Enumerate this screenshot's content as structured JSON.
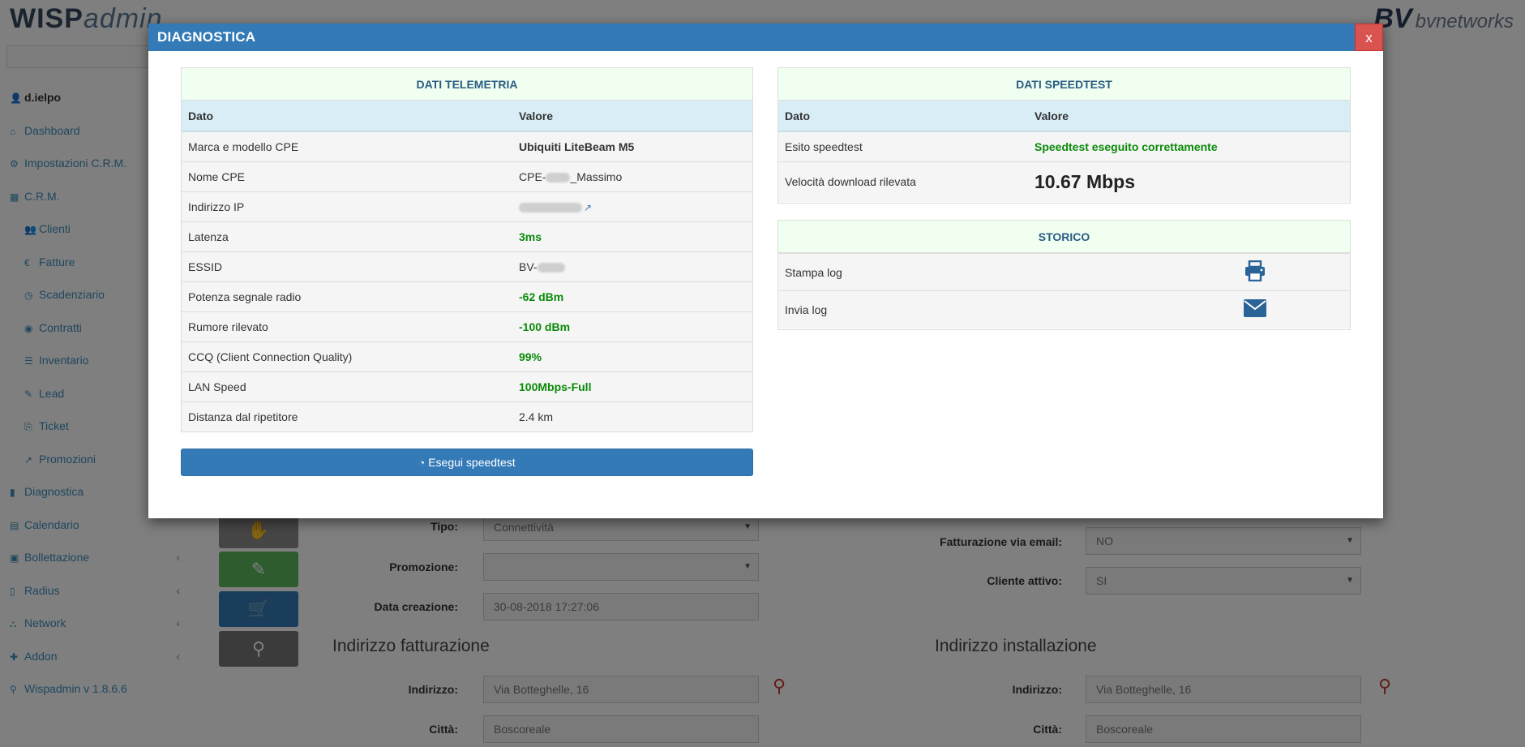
{
  "background": {
    "logo": {
      "main": "WISP",
      "sub": "admin"
    },
    "brand": {
      "mark": "BV",
      "name": "bvnetworks"
    },
    "sidebar": [
      {
        "icon": "user-icon",
        "glyph": "👤",
        "label": "d.ielpo",
        "type": "user"
      },
      {
        "icon": "dashboard-icon",
        "glyph": "⌂",
        "label": "Dashboard"
      },
      {
        "icon": "settings-icon",
        "glyph": "⚙",
        "label": "Impostazioni C.R.M."
      },
      {
        "icon": "table-icon",
        "glyph": "▦",
        "label": "C.R.M."
      },
      {
        "icon": "users-icon",
        "glyph": "👥",
        "label": "Clienti",
        "sub": true
      },
      {
        "icon": "euro-icon",
        "glyph": "€",
        "label": "Fatture",
        "sub": true
      },
      {
        "icon": "clock-icon",
        "glyph": "◷",
        "label": "Scadenziario",
        "sub": true
      },
      {
        "icon": "eye-icon",
        "glyph": "◉",
        "label": "Contratti",
        "sub": true
      },
      {
        "icon": "list-icon",
        "glyph": "☰",
        "label": "Inventario",
        "sub": true
      },
      {
        "icon": "edit-icon",
        "glyph": "✎",
        "label": "Lead",
        "sub": true
      },
      {
        "icon": "ticket-icon",
        "glyph": "⎘",
        "label": "Ticket",
        "sub": true
      },
      {
        "icon": "chart-icon",
        "glyph": "↗",
        "label": "Promozioni",
        "sub": true
      },
      {
        "icon": "bar-chart-icon",
        "glyph": "▮",
        "label": "Diagnostica"
      },
      {
        "icon": "calendar-icon",
        "glyph": "▤",
        "label": "Calendario"
      },
      {
        "icon": "money-icon",
        "glyph": "▣",
        "label": "Bollettazione",
        "chev": true
      },
      {
        "icon": "file-icon",
        "glyph": "▯",
        "label": "Radius",
        "chev": true
      },
      {
        "icon": "network-icon",
        "glyph": "⛬",
        "label": "Network",
        "chev": true
      },
      {
        "icon": "addon-icon",
        "glyph": "✚",
        "label": "Addon",
        "chev": true
      },
      {
        "icon": "pin-icon",
        "glyph": "⚲",
        "label": "Wispadmin v 1.8.6.6"
      }
    ],
    "form": {
      "tipo_label": "Tipo:",
      "tipo_value": "Connettività",
      "promozione_label": "Promozione:",
      "promozione_value": "",
      "data_creazione_label": "Data creazione:",
      "data_creazione_value": "30-08-2018 17:27:06",
      "fatt_email_label": "Fatturazione via email:",
      "fatt_email_value": "NO",
      "cliente_attivo_label": "Cliente attivo:",
      "cliente_attivo_value": "SI",
      "indirizzo_fatturazione": "Indirizzo fatturazione",
      "indirizzo_installazione": "Indirizzo installazione",
      "indirizzo_label": "Indirizzo:",
      "indirizzo_value": "Via Botteghelle, 16",
      "citta_label": "Città:",
      "citta_value": "Boscoreale"
    }
  },
  "modal": {
    "title": "DIAGNOSTICA",
    "close_label": "x",
    "telemetry": {
      "title": "DATI TELEMETRIA",
      "col_dato": "Dato",
      "col_valore": "Valore",
      "rows": [
        {
          "label": "Marca e modello CPE",
          "value": "Ubiquiti LiteBeam M5",
          "style": "bold"
        },
        {
          "label": "Nome CPE",
          "value_prefix": "CPE-",
          "value_suffix": "_Massimo",
          "redacted": true
        },
        {
          "label": "Indirizzo IP",
          "redacted_only": true,
          "link": true
        },
        {
          "label": "Latenza",
          "value": "3ms",
          "style": "green"
        },
        {
          "label": "ESSID",
          "value_prefix": "BV-",
          "redacted": true
        },
        {
          "label": "Potenza segnale radio",
          "value": "-62 dBm",
          "style": "green"
        },
        {
          "label": "Rumore rilevato",
          "value": "-100 dBm",
          "style": "green"
        },
        {
          "label": "CCQ (Client Connection Quality)",
          "value": "99%",
          "style": "green"
        },
        {
          "label": "LAN Speed",
          "value": "100Mbps-Full",
          "style": "green"
        },
        {
          "label": "Distanza dal ripetitore",
          "value": "2.4 km",
          "style": "normal"
        }
      ]
    },
    "speedtest": {
      "title": "DATI SPEEDTEST",
      "col_dato": "Dato",
      "col_valore": "Valore",
      "esito_label": "Esito speedtest",
      "esito_value": "Speedtest eseguito correttamente",
      "velocita_label": "Velocità download rilevata",
      "velocita_value": "10.67 Mbps"
    },
    "storico": {
      "title": "STORICO",
      "stampa_label": "Stampa log",
      "invia_label": "Invia log",
      "stampa_icon": "print-icon",
      "invia_icon": "envelope-icon"
    },
    "speedtest_button": "Esegui speedtest",
    "colors": {
      "header_blue": "#337ab7",
      "close_red": "#d9534f",
      "ok_green": "#0a8a0a",
      "panel_head_bg": "#f0fff0",
      "table_head_bg": "#d9edf7"
    }
  }
}
